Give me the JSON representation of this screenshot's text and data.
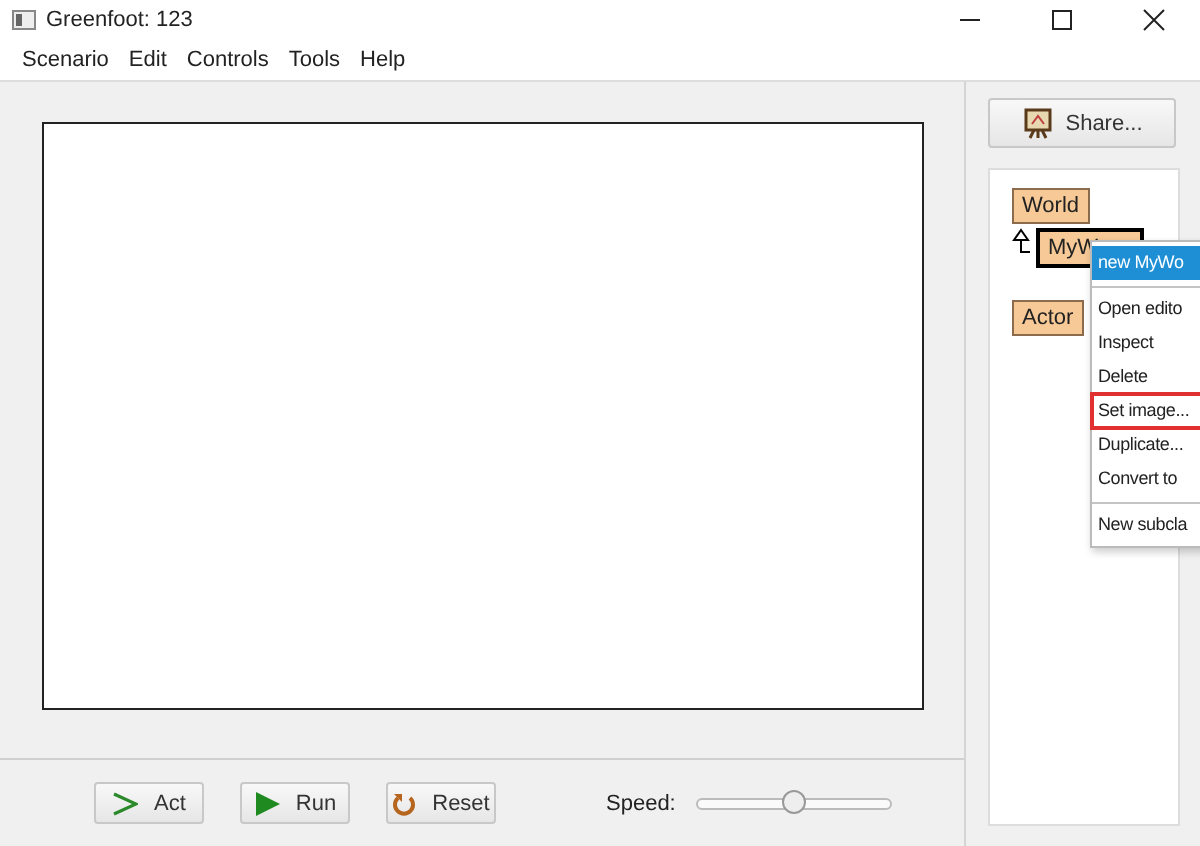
{
  "window": {
    "title": "Greenfoot: 123"
  },
  "menu_bar": [
    "Scenario",
    "Edit",
    "Controls",
    "Tools",
    "Help"
  ],
  "share_button": "Share...",
  "classes": [
    {
      "name": "World",
      "selected": false,
      "children": [
        {
          "name": "MyW",
          "selected": true
        }
      ]
    },
    {
      "name": "Actor",
      "selected": false
    }
  ],
  "context_menu": [
    {
      "label": "new MyWo",
      "selected": true,
      "highlighted": false,
      "separator_before": false
    },
    {
      "label": "Open edito",
      "selected": false,
      "highlighted": false,
      "separator_before": true
    },
    {
      "label": "Inspect",
      "selected": false,
      "highlighted": false,
      "separator_before": false
    },
    {
      "label": "Delete",
      "selected": false,
      "highlighted": false,
      "separator_before": false
    },
    {
      "label": "Set image...",
      "selected": false,
      "highlighted": true,
      "separator_before": false
    },
    {
      "label": "Duplicate...",
      "selected": false,
      "highlighted": false,
      "separator_before": false
    },
    {
      "label": "Convert to",
      "selected": false,
      "highlighted": false,
      "separator_before": false
    },
    {
      "label": "New subcla",
      "selected": false,
      "highlighted": false,
      "separator_before": true
    }
  ],
  "controls": [
    {
      "kind": "act",
      "label": "Act"
    },
    {
      "kind": "run",
      "label": "Run"
    },
    {
      "kind": "reset",
      "label": "Reset"
    }
  ],
  "speed": {
    "label": "Speed:",
    "level": 0.5
  }
}
